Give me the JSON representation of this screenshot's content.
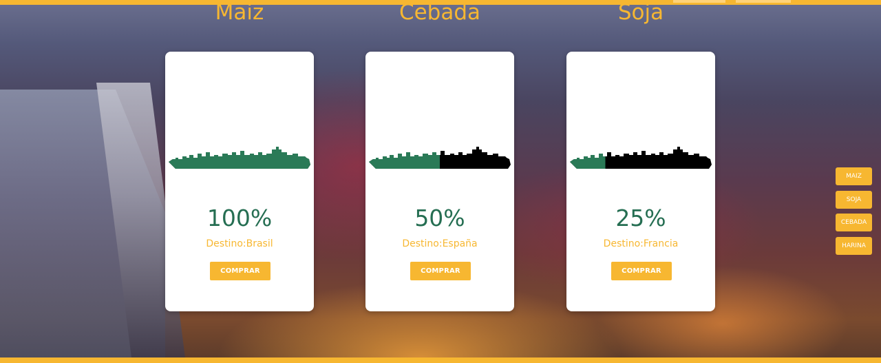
{
  "colors": {
    "accent": "#f7b731",
    "filled_green": "#256e52",
    "ship_green": "#2a7a57",
    "ship_empty": "#000000",
    "card_bg": "#ffffff"
  },
  "cards": [
    {
      "title": "Maiz",
      "percent_label": "100%",
      "fill": 1.0,
      "destination": "Destino:Brasil",
      "button": "COMPRAR"
    },
    {
      "title": "Cebada",
      "percent_label": "50%",
      "fill": 0.5,
      "destination": "Destino:España",
      "button": "COMPRAR"
    },
    {
      "title": "Soja",
      "percent_label": "25%",
      "fill": 0.25,
      "destination": "Destino:Francia",
      "button": "COMPRAR"
    }
  ],
  "side_nav": [
    "MAIZ",
    "SOJA",
    "CEBADA",
    "HARINA"
  ],
  "icons": {
    "ship": "cargo-ship-silhouette-icon"
  }
}
